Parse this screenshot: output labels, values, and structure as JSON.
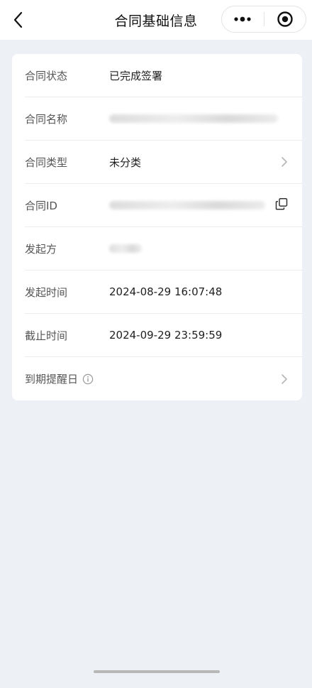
{
  "header": {
    "title": "合同基础信息",
    "back_icon": "chevron-left-icon",
    "more_icon": "more-dots-icon",
    "close_icon": "target-circle-icon"
  },
  "details": [
    {
      "key": "status",
      "label": "合同状态",
      "value": "已完成签署"
    },
    {
      "key": "name",
      "label": "合同名称",
      "value": ""
    },
    {
      "key": "type",
      "label": "合同类型",
      "value": "未分类"
    },
    {
      "key": "id",
      "label": "合同ID",
      "value": ""
    },
    {
      "key": "initiator",
      "label": "发起方",
      "value": ""
    },
    {
      "key": "start_time",
      "label": "发起时间",
      "value": "2024-08-29 16:07:48"
    },
    {
      "key": "deadline",
      "label": "截止时间",
      "value": "2024-09-29 23:59:59"
    },
    {
      "key": "reminder",
      "label": "到期提醒日",
      "value": ""
    }
  ],
  "colors": {
    "page_bg": "#edf0f4",
    "card_bg": "#ffffff",
    "label": "#555555",
    "value": "#1f1f1f"
  }
}
